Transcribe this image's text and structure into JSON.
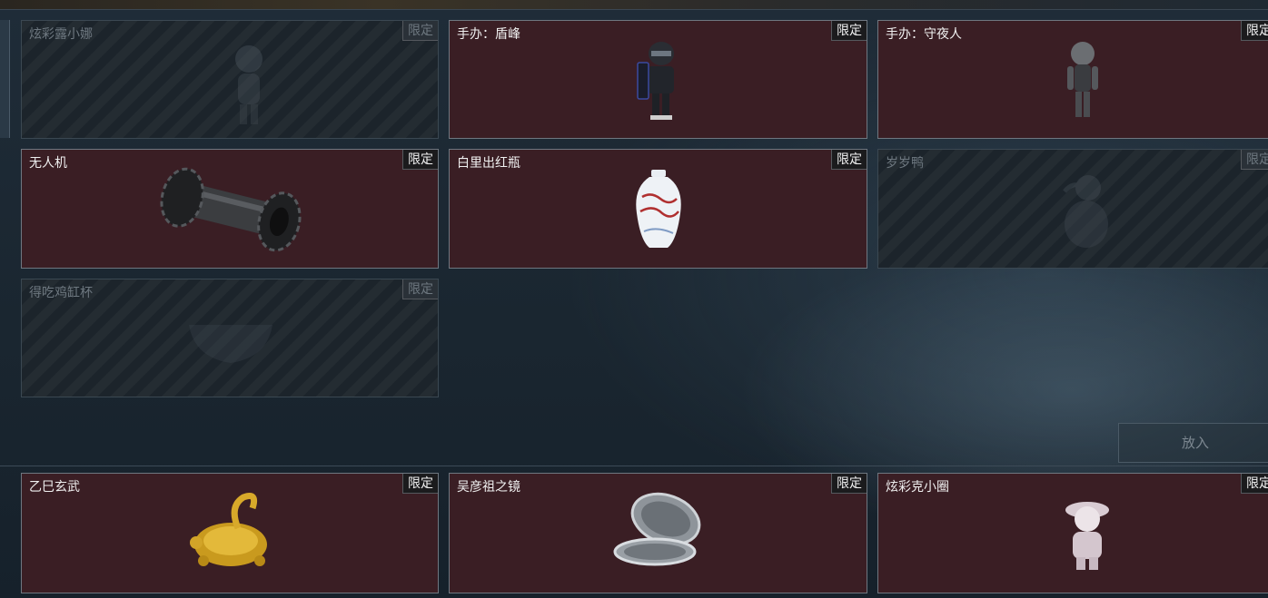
{
  "grid_items": [
    {
      "name": "炫彩露小娜",
      "tag": "限定",
      "state": "locked",
      "icon": "figure-girl-icon"
    },
    {
      "name": "手办：盾峰",
      "tag": "限定",
      "state": "owned",
      "icon": "figure-riot-soldier-icon"
    },
    {
      "name": "手办：守夜人",
      "tag": "限定",
      "state": "owned",
      "icon": "figure-night-watcher-icon"
    },
    {
      "name": "无人机",
      "tag": "限定",
      "state": "owned",
      "icon": "drone-roller-icon"
    },
    {
      "name": "白里出红瓶",
      "tag": "限定",
      "state": "owned",
      "icon": "porcelain-vase-icon"
    },
    {
      "name": "岁岁鸭",
      "tag": "限定",
      "state": "locked",
      "icon": "duck-icon"
    },
    {
      "name": "得吃鸡缸杯",
      "tag": "限定",
      "state": "locked",
      "icon": "chicken-cup-icon"
    }
  ],
  "bottom_items": [
    {
      "name": "乙巳玄武",
      "tag": "限定",
      "state": "owned",
      "icon": "golden-snake-turtle-icon"
    },
    {
      "name": "吴彦祖之镜",
      "tag": "限定",
      "state": "owned",
      "icon": "compact-mirror-icon"
    },
    {
      "name": "炫彩克小圈",
      "tag": "限定",
      "state": "owned",
      "icon": "figure-girl-hat-icon"
    }
  ],
  "put_button_label": "放入",
  "colors": {
    "owned_card_bg": "#3a1e24",
    "locked_card_bg": "#1c242b",
    "tag_bg": "#1b1b1d",
    "page_bg": "#1f2c38"
  }
}
